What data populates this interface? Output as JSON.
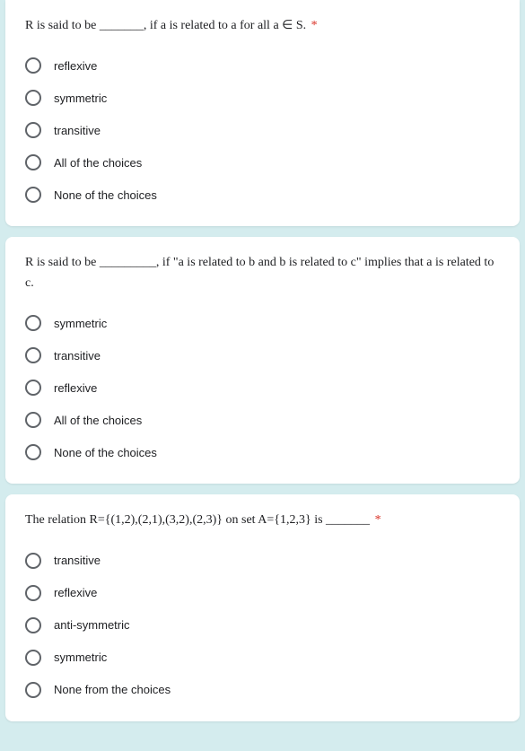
{
  "required_marker": "*",
  "questions": [
    {
      "prompt": "R is said to be _______, if a is related to a for all a ∈ S.",
      "required": true,
      "options": [
        "reflexive",
        "symmetric",
        "transitive",
        "All of the choices",
        "None of the choices"
      ]
    },
    {
      "prompt": "R is said to be _________, if \"a is related to b and b is related to c\" implies that a is related to c.",
      "required": false,
      "options": [
        "symmetric",
        "transitive",
        "reflexive",
        "All of the choices",
        "None of the choices"
      ]
    },
    {
      "prompt": "The relation R={(1,2),(2,1),(3,2),(2,3)} on set A={1,2,3} is _______",
      "required": true,
      "options": [
        "transitive",
        "reflexive",
        "anti-symmetric",
        "symmetric",
        "None from the choices"
      ]
    }
  ]
}
